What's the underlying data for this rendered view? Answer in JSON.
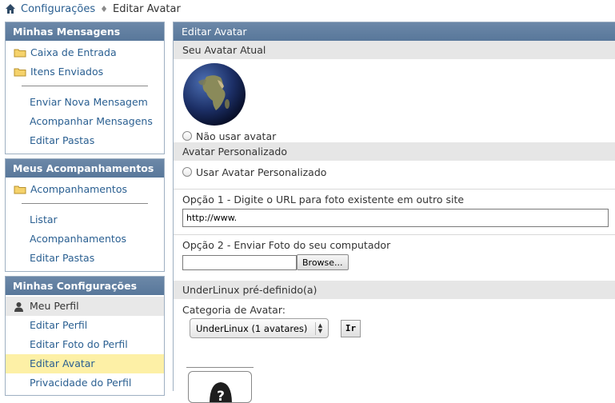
{
  "breadcrumb": {
    "home_icon": "home-icon",
    "items": [
      "Configurações",
      "Editar Avatar"
    ]
  },
  "sidebar": {
    "messages": {
      "title": "Minhas Mensagens",
      "items": [
        "Caixa de Entrada",
        "Itens Enviados"
      ],
      "links": [
        "Enviar Nova Mensagem",
        "Acompanhar Mensagens",
        "Editar Pastas"
      ]
    },
    "subscriptions": {
      "title": "Meus Acompanhamentos",
      "items": [
        "Acompanhamentos"
      ],
      "links": [
        "Listar",
        "Acompanhamentos",
        "Editar Pastas"
      ]
    },
    "settings": {
      "title": "Minhas Configurações",
      "profile_label": "Meu Perfil",
      "links": [
        "Editar Perfil",
        "Editar Foto do Perfil",
        "Editar Avatar",
        "Privacidade do Perfil"
      ],
      "active_index": 2
    }
  },
  "main": {
    "title": "Editar Avatar",
    "current_avatar": {
      "heading": "Seu Avatar Atual",
      "no_avatar_label": "Não usar avatar"
    },
    "custom_avatar": {
      "heading": "Avatar Personalizado",
      "use_custom_label": "Usar Avatar Personalizado",
      "option1_label": "Opção 1 - Digite o URL para foto existente em outro site",
      "option1_value": "http://www.",
      "option2_label": "Opção 2 - Enviar Foto do seu computador",
      "browse_label": "Browse..."
    },
    "predefined": {
      "heading": "UnderLinux pré-definido(a)",
      "category_label": "Categoria de Avatar:",
      "category_selected": "UnderLinux (1 avatares)",
      "go_label": "Ir"
    }
  },
  "colors": {
    "header_blue": "#6c88a8",
    "link_blue": "#2a5f91",
    "active_highlight": "#fdf0a6"
  }
}
